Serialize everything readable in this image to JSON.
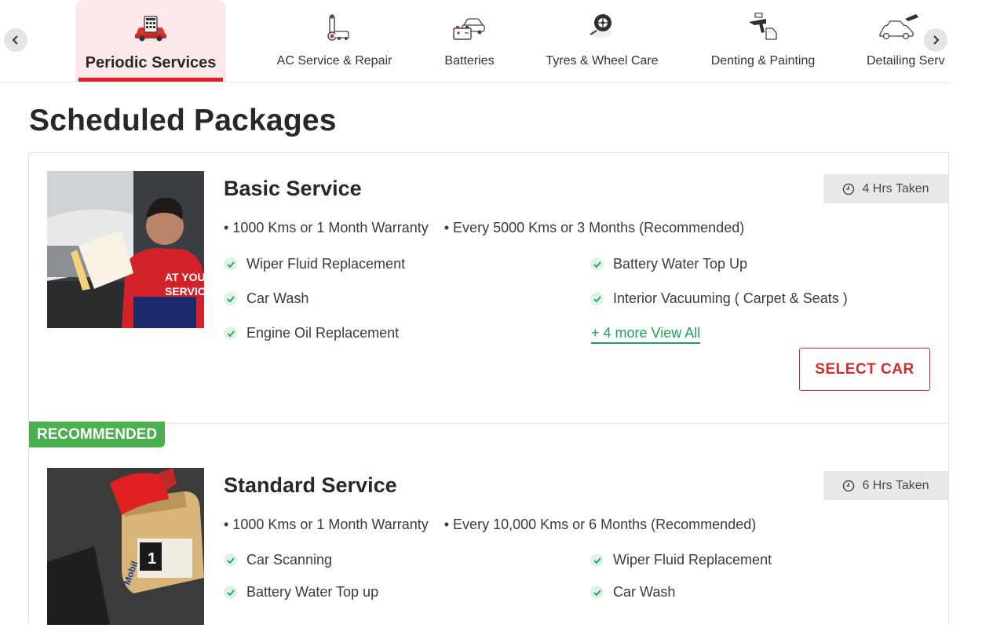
{
  "categories": [
    {
      "label": "Periodic Services",
      "icon": "car-service-icon",
      "active": true
    },
    {
      "label": "AC Service & Repair",
      "icon": "ac-thermometer-icon",
      "active": false
    },
    {
      "label": "Batteries",
      "icon": "car-battery-icon",
      "active": false
    },
    {
      "label": "Tyres & Wheel Care",
      "icon": "tyre-icon",
      "active": false
    },
    {
      "label": "Denting & Painting",
      "icon": "spray-gun-icon",
      "active": false
    },
    {
      "label": "Detailing Serv",
      "icon": "car-detailing-icon",
      "active": false
    }
  ],
  "nav": {
    "prev_icon": "chevron-left-icon",
    "next_icon": "chevron-right-icon"
  },
  "page_title": "Scheduled Packages",
  "packages": [
    {
      "title": "Basic Service",
      "time": "4 Hrs Taken",
      "specs": [
        "• 1000 Kms or 1 Month Warranty",
        "• Every 5000 Kms or 3 Months (Recommended)"
      ],
      "features_left": [
        "Wiper Fluid Replacement",
        "Car Wash",
        "Engine Oil Replacement"
      ],
      "features_right": [
        "Battery Water Top Up",
        "Interior Vacuuming ( Carpet & Seats )"
      ],
      "more_link": "+ 4 more View All",
      "cta": "SELECT CAR"
    },
    {
      "badge": "RECOMMENDED",
      "title": "Standard Service",
      "time": "6 Hrs Taken",
      "specs": [
        "• 1000 Kms or 1 Month Warranty",
        "• Every 10,000 Kms or 6 Months (Recommended)"
      ],
      "features_left": [
        "Car Scanning",
        "Battery Water Top up"
      ],
      "features_right": [
        "Wiper Fluid Replacement",
        "Car Wash"
      ]
    }
  ],
  "colors": {
    "accent_red": "#e41e26",
    "cta_red": "#d12c2c",
    "check_green": "#20a05a",
    "badge_green": "#4caf50",
    "active_tab_bg": "#fde9e9"
  }
}
